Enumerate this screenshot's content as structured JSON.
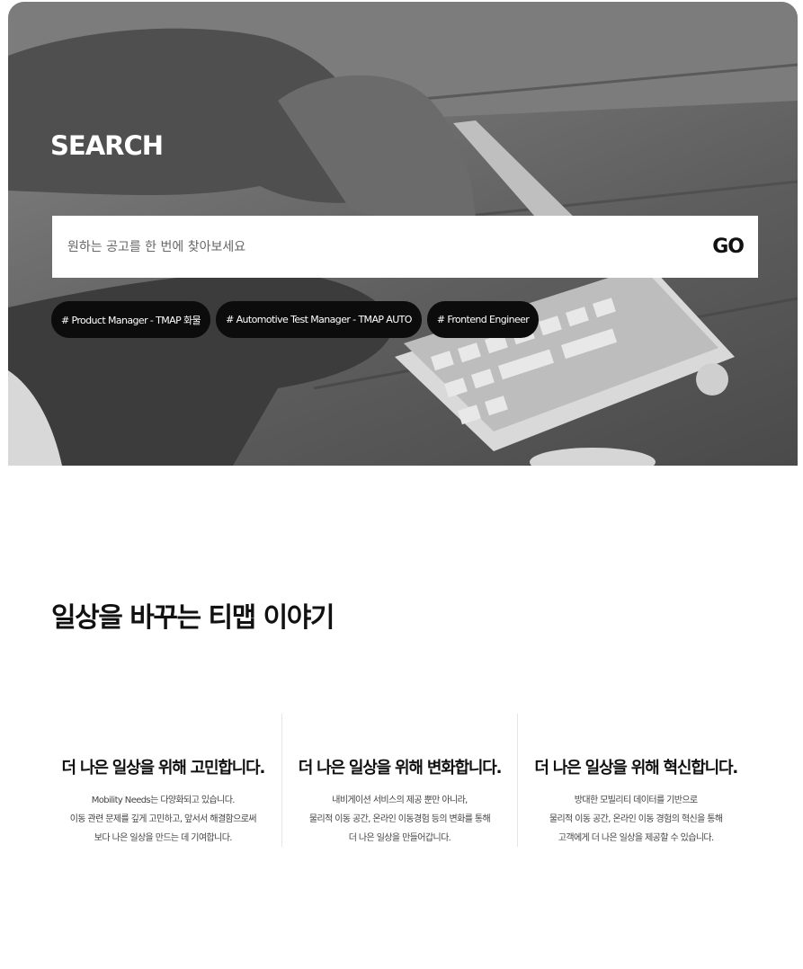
{
  "hero": {
    "title": "SEARCH",
    "search": {
      "placeholder": "원하는 공고를 한 번에 찾아보세요",
      "value": "",
      "go_label": "GO"
    },
    "tags": [
      "# Product Manager - TMAP 화물",
      "# Automotive Test Manager - TMAP AUTO",
      "# Frontend Engineer"
    ]
  },
  "stories": {
    "title": "일상을 바꾸는 티맵 이야기",
    "cards": [
      {
        "title": "더 나은 일상을 위해 고민합니다.",
        "lines": [
          "Mobility Needs는 다양화되고 있습니다.",
          "이동 관련 문제를 깊게 고민하고, 앞서서 해결함으로써",
          "보다 나은 일상을 만드는 데 기여합니다."
        ]
      },
      {
        "title": "더 나은 일상을 위해 변화합니다.",
        "lines": [
          "내비게이션 서비스의 제공 뿐만 아니라,",
          "물리적 이동 공간, 온라인 이동경험 등의 변화를 통해",
          "더 나은 일상을 만들어갑니다."
        ]
      },
      {
        "title": "더 나은 일상을 위해 혁신합니다.",
        "lines": [
          "방대한 모빌리티 데이터를 기반으로",
          "물리적 이동 공간, 온라인 이동 경험의 혁신을 통해",
          "고객에게 더 나은 일상을 제공할 수 있습니다."
        ]
      }
    ]
  }
}
